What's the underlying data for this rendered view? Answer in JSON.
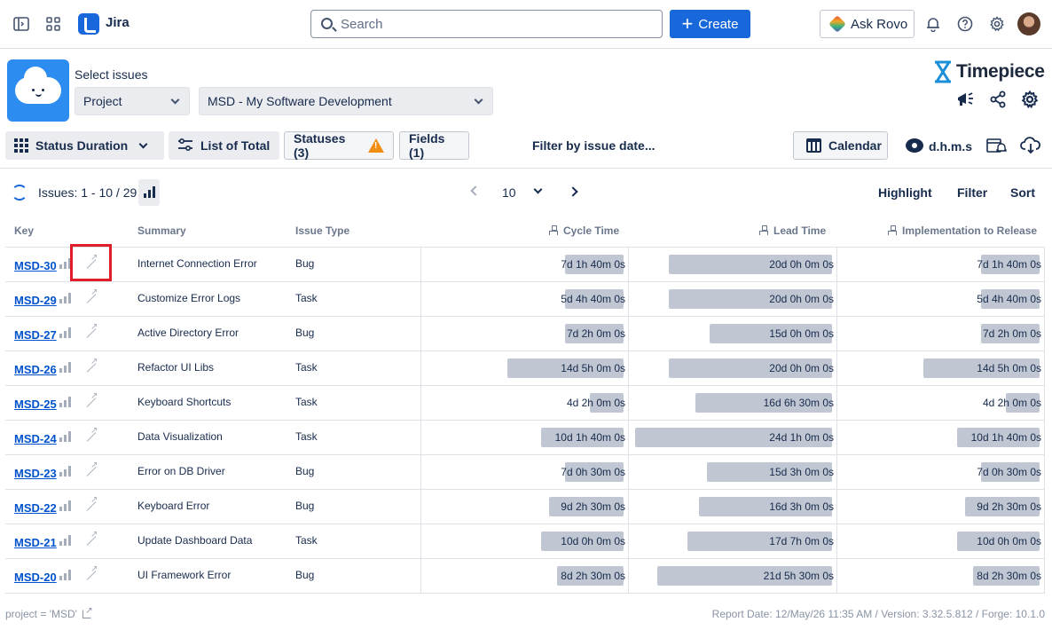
{
  "topbar": {
    "app_name": "Jira",
    "search_placeholder": "Search",
    "create_label": "Create",
    "rovo_label": "Ask Rovo"
  },
  "header": {
    "select_issues_label": "Select issues",
    "scope_dropdown": "Project",
    "project_dropdown": "MSD - My Software Development",
    "brand": "Timepiece"
  },
  "toolbar": {
    "status_duration_label": "Status Duration",
    "list_of_total_label": "List of Total",
    "statuses_label": "Statuses (3)",
    "fields_label": "Fields (1)",
    "filter_date_label": "Filter by issue date...",
    "calendar_label": "Calendar",
    "time_format_label": "d.h.m.s"
  },
  "issues_bar": {
    "count_label": "Issues: 1 - 10 / 29",
    "page_size": "10",
    "highlight_label": "Highlight",
    "filter_label": "Filter",
    "sort_label": "Sort"
  },
  "table": {
    "columns": [
      "Key",
      "Summary",
      "Issue Type",
      "Cycle Time",
      "Lead Time",
      "Implementation to Release"
    ],
    "rows": [
      {
        "key": "MSD-30",
        "summary": "Internet Connection Error",
        "type": "Bug",
        "cycle": "7d 1h 40m 0s",
        "cycle_fill": 0.29,
        "lead": "20d 0h 0m 0s",
        "lead_fill": 0.81,
        "impl": "7d 1h 40m 0s",
        "impl_fill": 0.29
      },
      {
        "key": "MSD-29",
        "summary": "Customize Error Logs",
        "type": "Task",
        "cycle": "5d 4h 40m 0s",
        "cycle_fill": 0.29,
        "lead": "20d 0h 0m 0s",
        "lead_fill": 0.81,
        "impl": "5d 4h 40m 0s",
        "impl_fill": 0.29
      },
      {
        "key": "MSD-27",
        "summary": "Active Directory Error",
        "type": "Bug",
        "cycle": "7d 2h 0m 0s",
        "cycle_fill": 0.29,
        "lead": "15d 0h 0m 0s",
        "lead_fill": 0.61,
        "impl": "7d 2h 0m 0s",
        "impl_fill": 0.29
      },
      {
        "key": "MSD-26",
        "summary": "Refactor UI Libs",
        "type": "Task",
        "cycle": "14d 5h 0m 0s",
        "cycle_fill": 0.58,
        "lead": "20d 0h 0m 0s",
        "lead_fill": 0.81,
        "impl": "14d 5h 0m 0s",
        "impl_fill": 0.58
      },
      {
        "key": "MSD-25",
        "summary": "Keyboard Shortcuts",
        "type": "Task",
        "cycle": "4d 2h 0m 0s",
        "cycle_fill": 0.17,
        "lead": "16d 6h 30m 0s",
        "lead_fill": 0.68,
        "impl": "4d 2h 0m 0s",
        "impl_fill": 0.17
      },
      {
        "key": "MSD-24",
        "summary": "Data Visualization",
        "type": "Task",
        "cycle": "10d 1h 40m 0s",
        "cycle_fill": 0.41,
        "lead": "24d 1h 0m 0s",
        "lead_fill": 0.98,
        "impl": "10d 1h 40m 0s",
        "impl_fill": 0.41
      },
      {
        "key": "MSD-23",
        "summary": "Error on DB Driver",
        "type": "Bug",
        "cycle": "7d 0h 30m 0s",
        "cycle_fill": 0.29,
        "lead": "15d 3h 0m 0s",
        "lead_fill": 0.62,
        "impl": "7d 0h 30m 0s",
        "impl_fill": 0.29
      },
      {
        "key": "MSD-22",
        "summary": "Keyboard Error",
        "type": "Bug",
        "cycle": "9d 2h 30m 0s",
        "cycle_fill": 0.37,
        "lead": "16d 3h 0m 0s",
        "lead_fill": 0.66,
        "impl": "9d 2h 30m 0s",
        "impl_fill": 0.37
      },
      {
        "key": "MSD-21",
        "summary": "Update Dashboard Data",
        "type": "Task",
        "cycle": "10d 0h 0m 0s",
        "cycle_fill": 0.41,
        "lead": "17d 7h 0m 0s",
        "lead_fill": 0.72,
        "impl": "10d 0h 0m 0s",
        "impl_fill": 0.41
      },
      {
        "key": "MSD-20",
        "summary": "UI Framework Error",
        "type": "Bug",
        "cycle": "8d 2h 30m 0s",
        "cycle_fill": 0.33,
        "lead": "21d 5h 30m 0s",
        "lead_fill": 0.87,
        "impl": "8d 2h 30m 0s",
        "impl_fill": 0.33
      }
    ]
  },
  "footer": {
    "query": "project = 'MSD'",
    "report_info": "Report Date: 12/May/26 11:35 AM / Version: 3.32.5.812 / Forge: 10.1.0"
  },
  "colors": {
    "accent": "#1868db",
    "bar": "#c1c7d2",
    "warning": "#f18d13",
    "highlight_box": "#e11d2a"
  }
}
